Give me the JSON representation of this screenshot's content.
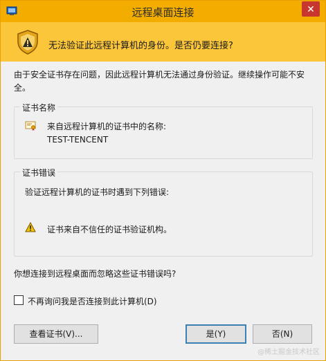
{
  "window": {
    "title": "远程桌面连接",
    "close_label": "✕"
  },
  "banner": {
    "text": "无法验证此远程计算机的身份。是否仍要连接?"
  },
  "description": "由于安全证书存在问题，因此远程计算机无法通过身份验证。继续操作可能不安全。",
  "cert_group": {
    "title": "证书名称",
    "from_label": "来自远程计算机的证书中的名称:",
    "name": "TEST-TENCENT"
  },
  "error_group": {
    "title": "证书错误",
    "intro": "验证远程计算机的证书时遇到下列错误:",
    "error_text": "证书来自不信任的证书验证机构。"
  },
  "question": "你想连接到远程桌面而忽略这些证书错误吗?",
  "checkbox": {
    "label": "不再询问我是否连接到此计算机(D)",
    "checked": false
  },
  "buttons": {
    "view_cert": "查看证书(V)...",
    "yes": "是(Y)",
    "no": "否(N)"
  },
  "watermark": "@稀土掘金技术社区",
  "colors": {
    "titlebar": "#f2ad00",
    "banner": "#fbc63a",
    "close": "#c7372f",
    "background": "#f0f0f0"
  },
  "icons": {
    "app": "remote-desktop-icon",
    "banner": "warning-shield-icon",
    "cert": "certificate-icon",
    "error": "warning-triangle-icon"
  }
}
